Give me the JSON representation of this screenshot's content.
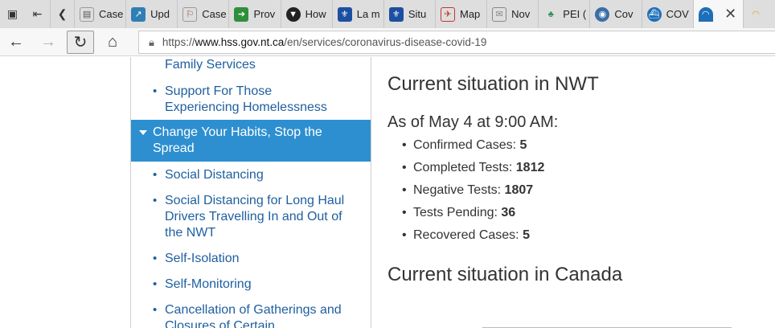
{
  "tabs": [
    {
      "label": "Case",
      "icon": "document-icon",
      "color": "#ffffff"
    },
    {
      "label": "Upd",
      "icon": "chart-icon",
      "color": "#2f7fb5"
    },
    {
      "label": "Case",
      "icon": "document-icon",
      "color": "#ffffff"
    },
    {
      "label": "Prov",
      "icon": "flag-icon",
      "color": "#2f8f3a"
    },
    {
      "label": "How",
      "icon": "shield-icon",
      "color": "#222222"
    },
    {
      "label": "La m",
      "icon": "fleur-de-lis-icon",
      "color": "#1d4fa0"
    },
    {
      "label": "Situ",
      "icon": "fleur-de-lis-icon",
      "color": "#1d4fa0"
    },
    {
      "label": "Map",
      "icon": "map-icon",
      "color": "#c0392b"
    },
    {
      "label": "Nov",
      "icon": "envelope-icon",
      "color": "#888888"
    },
    {
      "label": "PEI (",
      "icon": "gov-icon",
      "color": "#2e8b57"
    },
    {
      "label": "Cov",
      "icon": "globe-icon",
      "color": "#3a6ea5"
    },
    {
      "label": "COV",
      "icon": "ship-icon",
      "color": "#1d6fb8"
    }
  ],
  "active_tab": {
    "icon": "nwt-icon",
    "close_label": "✕"
  },
  "address": {
    "prefix": "https://",
    "domain": "www.hss.gov.nt.ca",
    "path": "/en/services/coronavirus-disease-covid-19"
  },
  "sidebar": {
    "top_item": "Family Services",
    "items_before": [
      "Support For Those Experiencing Homelessness"
    ],
    "active_item": "Change Your Habits, Stop the Spread",
    "items_after": [
      "Social Distancing",
      "Social Distancing for Long Haul Drivers Travelling In and Out of the NWT",
      "Self-Isolation",
      "Self-Monitoring",
      "Cancellation of Gatherings and Closures of Certain"
    ]
  },
  "content": {
    "heading_nwt": "Current situation in NWT",
    "as_of": "As of May 4 at 9:00 AM:",
    "stats": [
      {
        "label": "Confirmed Cases:",
        "value": "5"
      },
      {
        "label": "Completed Tests:",
        "value": "1812"
      },
      {
        "label": "Negative Tests:",
        "value": "1807"
      },
      {
        "label": "Tests Pending:",
        "value": "36"
      },
      {
        "label": "Recovered Cases:",
        "value": "5"
      }
    ],
    "heading_canada": "Current situation in Canada"
  }
}
